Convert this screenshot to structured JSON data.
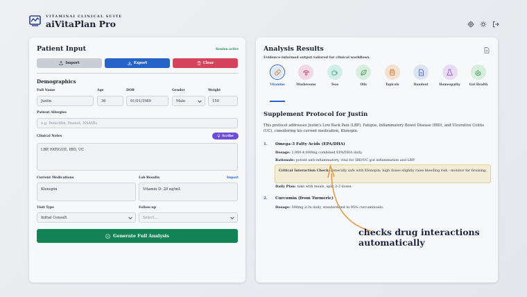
{
  "header": {
    "suite": "VITAMINAI CLINICAL SUITE",
    "title": "aiVitaPlan Pro",
    "icons": [
      "gear-icon",
      "sun-icon",
      "logout-icon"
    ]
  },
  "patient_input": {
    "title": "Patient Input",
    "session": "Session active",
    "buttons": {
      "import": "Import",
      "export": "Export",
      "clear": "Clear"
    },
    "demographics_heading": "Demographics",
    "labels": {
      "full_name": "Full Name",
      "age": "Age",
      "dob": "DOB",
      "gender": "Gender",
      "weight": "Weight",
      "allergies": "Patient Allergies",
      "notes": "Clinical Notes",
      "medications": "Current Medications",
      "labs": "Lab Results",
      "visit_type": "Visit Type",
      "follow_up": "Follow-up"
    },
    "values": {
      "full_name": "Justin",
      "age": "36",
      "dob": "01/01/1980",
      "gender": "Male",
      "weight": "150",
      "notes": "LBP, FATIGUE, IBD, UC",
      "medications": "Klonopin",
      "labs": "Vitamin D: 20 ng/mL",
      "visit_type": "Initial Consult"
    },
    "placeholders": {
      "allergies": "e.g. Penicillin, Peanut, NSAIDs",
      "follow_up": "Select..."
    },
    "scribe": "Scribe",
    "import_link": "Import",
    "generate": "Generate Full Analysis"
  },
  "analysis": {
    "title": "Analysis Results",
    "subtitle": "Evidence-informed output tailored for clinical workflows.",
    "tabs": [
      {
        "label": "Vitamins",
        "color": "#dbe6f7",
        "icon": "pill-icon"
      },
      {
        "label": "Mushrooms",
        "color": "#efd9e3",
        "icon": "mushroom-icon"
      },
      {
        "label": "Teas",
        "color": "#d3eee6",
        "icon": "tea-icon"
      },
      {
        "label": "Oils",
        "color": "#d7efdc",
        "icon": "leaf-icon"
      },
      {
        "label": "Topicals",
        "color": "#f3e2d2",
        "icon": "jar-icon"
      },
      {
        "label": "Handout",
        "color": "#dde3f2",
        "icon": "document-icon"
      },
      {
        "label": "Homeopathy",
        "color": "#e7dcf1",
        "icon": "flask-icon"
      },
      {
        "label": "Gut Health",
        "color": "#d8efdd",
        "icon": "gut-icon"
      }
    ],
    "protocol_title": "Supplement Protocol for Justin",
    "intro": "This protocol addresses Justin's Low Back Pain (LBP), Fatigue, Inflammatory Bowel Disease (IBD), and Ulcerative Colitis (UC), considering his current medication, Klonopin.",
    "items": [
      {
        "num": "1.",
        "title": "Omega-3 Fatty Acids (EPA/DHA)",
        "dosage_label": "Dosage:",
        "dosage": "2,000-4,000mg combined EPA/DHA daily.",
        "rationale_label": "Rationale:",
        "rationale": "potent anti-inflammatory, vital for IBD/UC gut inflammation and LBP.",
        "critical_label": "Critical Interaction Check:",
        "critical": "generally safe with Klonopin; high doses slightly raise bleeding risk - monitor for bruising.",
        "plan_label": "Daily Plan:",
        "plan": "take with meals, split 2-3 doses."
      },
      {
        "num": "2.",
        "title": "Curcumin (from Turmeric)",
        "dosage_label": "Dosage:",
        "dosage": "500mg 2-3x daily, standardized to 95% curcuminoids."
      }
    ]
  },
  "annotation": "checks drug interactions automatically",
  "colors": {
    "accent": "#2563c9",
    "danger": "#d6435a",
    "success": "#138255",
    "scribe": "#6b4fd8",
    "arrow": "#e0913a"
  }
}
